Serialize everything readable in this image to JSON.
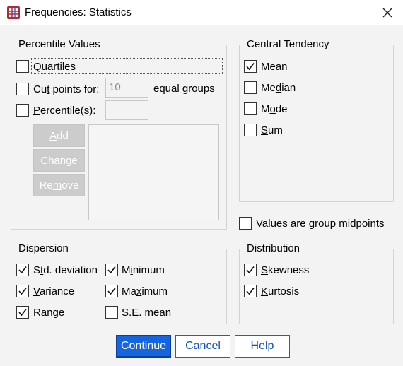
{
  "window": {
    "title": "Frequencies: Statistics"
  },
  "percentile_values": {
    "title": "Percentile Values",
    "quartiles_label": "Quartiles",
    "quartiles_checked": false,
    "cut_points_label": "Cut points for:",
    "cut_points_value": "10",
    "cut_points_suffix": "equal groups",
    "cut_points_checked": false,
    "percentiles_label": "Percentile(s):",
    "percentiles_value": "",
    "percentiles_checked": false,
    "add_label": "Add",
    "change_label": "Change",
    "remove_label": "Remove"
  },
  "central_tendency": {
    "title": "Central Tendency",
    "items": [
      {
        "label": "Mean",
        "checked": true
      },
      {
        "label": "Median",
        "checked": false
      },
      {
        "label": "Mode",
        "checked": false
      },
      {
        "label": "Sum",
        "checked": false
      }
    ]
  },
  "group_midpoints": {
    "label": "Values are group midpoints",
    "checked": false
  },
  "dispersion": {
    "title": "Dispersion",
    "items": [
      {
        "label": "Std. deviation",
        "checked": true
      },
      {
        "label": "Variance",
        "checked": true
      },
      {
        "label": "Range",
        "checked": true
      },
      {
        "label": "Minimum",
        "checked": true
      },
      {
        "label": "Maximum",
        "checked": true
      },
      {
        "label": "S.E. mean",
        "checked": false
      }
    ]
  },
  "distribution": {
    "title": "Distribution",
    "items": [
      {
        "label": "Skewness",
        "checked": true
      },
      {
        "label": "Kurtosis",
        "checked": true
      }
    ]
  },
  "buttons": {
    "continue": "Continue",
    "cancel": "Cancel",
    "help": "Help"
  },
  "colors": {
    "primary_button": "#1565e0",
    "link_blue": "#1450b8",
    "disabled_button": "#cccccc"
  }
}
